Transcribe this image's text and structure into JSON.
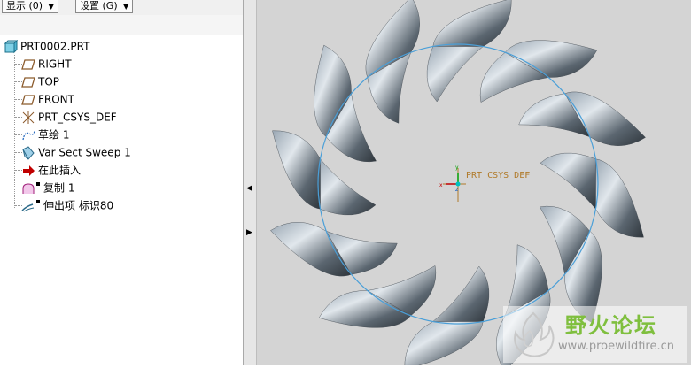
{
  "toolbar": {
    "show_label": "显示",
    "show_key": "(0)",
    "settings_label": "设置",
    "settings_key": "(G)"
  },
  "model_tree": {
    "root": "PRT0002.PRT",
    "items": [
      {
        "label": "RIGHT",
        "icon": "datum-plane-icon"
      },
      {
        "label": "TOP",
        "icon": "datum-plane-icon"
      },
      {
        "label": "FRONT",
        "icon": "datum-plane-icon"
      },
      {
        "label": "PRT_CSYS_DEF",
        "icon": "csys-icon"
      },
      {
        "label": "草绘 1",
        "icon": "sketch-icon"
      },
      {
        "label": "Var Sect Sweep 1",
        "icon": "sweep-icon"
      },
      {
        "label": "在此插入",
        "icon": "insert-here-arrow-icon"
      },
      {
        "label": "复制 1",
        "icon": "copy-feature-icon"
      },
      {
        "label": "伸出项 标识80",
        "icon": "protrusion-icon"
      }
    ]
  },
  "viewport": {
    "csys_label": "PRT_CSYS_DEF",
    "background": "#d4d4d4",
    "circle_color": "#4a9fd8"
  },
  "watermark": {
    "title": "野火论坛",
    "url": "www.proewildfire.cn"
  },
  "colors": {
    "datum": "#8b5a2b",
    "insert_arrow": "#c00000",
    "copy_icon": "#a0207a",
    "watermark_green": "#7fbf3e"
  }
}
